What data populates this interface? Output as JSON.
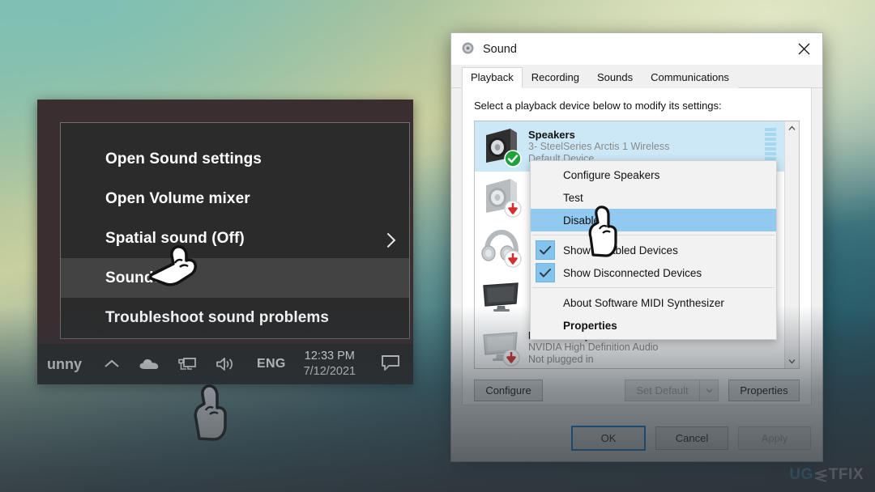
{
  "taskbar_flyout": {
    "items": [
      {
        "label": "Open Sound settings",
        "state": "normal",
        "chevron": false
      },
      {
        "label": "Open Volume mixer",
        "state": "normal",
        "chevron": false
      },
      {
        "label": "Spatial sound (Off)",
        "state": "normal",
        "chevron": true
      },
      {
        "label": "Sounds",
        "state": "highlighted",
        "chevron": false
      },
      {
        "label": "Troubleshoot sound problems",
        "state": "normal",
        "chevron": false
      }
    ]
  },
  "taskbar": {
    "window_label": "unny",
    "icons": [
      "chevron-up-icon",
      "onedrive-cloud-icon",
      "network-icon",
      "volume-icon"
    ],
    "language": "ENG",
    "time": "12:33 PM",
    "date": "7/12/2021",
    "action_center": "speech-bubble-icon"
  },
  "dialog": {
    "title": "Sound",
    "title_icon": "sound-speaker-icon",
    "close_label": "✕",
    "tabs": [
      {
        "label": "Playback",
        "active": true
      },
      {
        "label": "Recording",
        "active": false
      },
      {
        "label": "Sounds",
        "active": false
      },
      {
        "label": "Communications",
        "active": false
      }
    ],
    "hint": "Select a playback device below to modify its settings:",
    "devices": [
      {
        "name": "Speakers",
        "sub1": "3- SteelSeries Arctis 1 Wireless",
        "sub2": "Default Device",
        "icon": "speaker-icon",
        "badge": "green-check-badge",
        "selected": true,
        "has_meter": true
      },
      {
        "name": "",
        "sub1": "",
        "sub2": "",
        "icon": "speaker-icon-grey",
        "badge": "red-down-arrow-badge",
        "selected": false,
        "has_meter": false
      },
      {
        "name": "",
        "sub1": "",
        "sub2": "",
        "icon": "headphones-icon",
        "badge": "red-down-arrow-badge",
        "selected": false,
        "has_meter": false
      },
      {
        "name": "",
        "sub1": "",
        "sub2": "",
        "icon": "monitor-icon-dark",
        "badge": "",
        "selected": false,
        "has_meter": false
      },
      {
        "name": "NVIDIA Output",
        "sub1": "NVIDIA High Definition Audio",
        "sub2": "Not plugged in",
        "icon": "monitor-icon-light",
        "badge": "red-down-arrow-badge",
        "selected": false,
        "has_meter": false
      }
    ],
    "buttons": {
      "configure": "Configure",
      "set_default": "Set Default",
      "properties": "Properties",
      "ok": "OK",
      "cancel": "Cancel",
      "apply": "Apply"
    }
  },
  "context_menu": {
    "items": [
      {
        "label": "Configure Speakers",
        "selected": false,
        "checked": false,
        "bold": false
      },
      {
        "label": "Test",
        "selected": false,
        "checked": false,
        "bold": false
      },
      {
        "label": "Disable",
        "selected": true,
        "checked": false,
        "bold": false
      },
      {
        "label": "Show Disabled Devices",
        "selected": false,
        "checked": true,
        "bold": false
      },
      {
        "label": "Show Disconnected Devices",
        "selected": false,
        "checked": true,
        "bold": false
      },
      {
        "label": "About Software MIDI Synthesizer",
        "selected": false,
        "checked": false,
        "bold": false
      },
      {
        "label": "Properties",
        "selected": false,
        "checked": false,
        "bold": true
      }
    ]
  },
  "watermark": {
    "part1": "UG",
    "part2": "TFIX"
  },
  "colors": {
    "selection_blue": "#cce8f7",
    "menu_highlight": "#91c9f0",
    "accent_blue": "#0078d7",
    "meter_green": "#3aa93a",
    "badge_red": "#d42f2f"
  }
}
